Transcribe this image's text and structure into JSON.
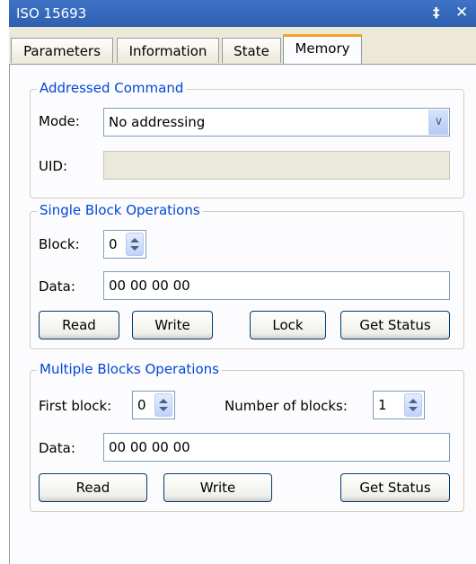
{
  "window": {
    "title": "ISO 15693",
    "pin_glyph": "q",
    "close_glyph": "✕"
  },
  "tabs": [
    {
      "label": "Parameters"
    },
    {
      "label": "Information"
    },
    {
      "label": "State"
    },
    {
      "label": "Memory",
      "active": true
    }
  ],
  "addressed": {
    "legend": "Addressed Command",
    "mode_label": "Mode:",
    "mode_value": "No addressing",
    "uid_label": "UID:",
    "uid_value": ""
  },
  "single": {
    "legend": "Single Block Operations",
    "block_label": "Block:",
    "block_value": "0",
    "data_label": "Data:",
    "data_value": "00 00 00 00",
    "read": "Read",
    "write": "Write",
    "lock": "Lock",
    "get_status": "Get Status"
  },
  "multiple": {
    "legend": "Multiple Blocks Operations",
    "first_block_label": "First block:",
    "first_block_value": "0",
    "count_label": "Number of blocks:",
    "count_value": "1",
    "data_label": "Data:",
    "data_value": "00 00 00 00",
    "read": "Read",
    "write": "Write",
    "get_status": "Get Status"
  },
  "colors": {
    "title_bar": "#2e5fb0",
    "legend_text": "#0046d5",
    "active_tab_accent": "#f5a12b"
  }
}
